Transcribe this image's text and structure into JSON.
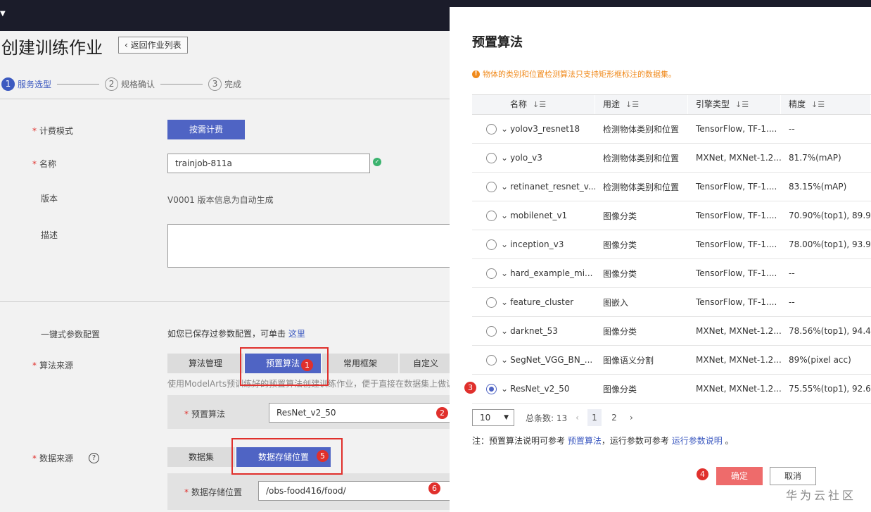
{
  "page": {
    "title": "创建训练作业",
    "back_label": "返回作业列表",
    "steps": [
      {
        "num": "1",
        "label": "服务选型"
      },
      {
        "num": "2",
        "label": "规格确认"
      },
      {
        "num": "3",
        "label": "完成"
      }
    ]
  },
  "form": {
    "billing_label": "计费模式",
    "billing_value": "按需计费",
    "name_label": "名称",
    "name_value": "trainjob-811a",
    "version_label": "版本",
    "version_value": "V0001 版本信息为自动生成",
    "desc_label": "描述",
    "oneclick_label": "一键式参数配置",
    "oneclick_text": "如您已保存过参数配置，可单击",
    "oneclick_link": "这里",
    "algo_source_label": "算法来源",
    "algo_tabs": [
      "算法管理",
      "预置算法",
      "常用框架",
      "自定义"
    ],
    "algo_hint": "使用ModelArts预训练好的预置算法创建训练作业，便于直接在数据集上做训",
    "preset_algo_label": "预置算法",
    "preset_algo_value": "ResNet_v2_50",
    "data_source_label": "数据来源",
    "data_tabs": [
      "数据集",
      "数据存储位置"
    ],
    "data_loc_label": "数据存储位置",
    "data_loc_value": "/obs-food416/food/"
  },
  "annotations": [
    "1",
    "2",
    "3",
    "4",
    "5",
    "6"
  ],
  "modal": {
    "title": "预置算法",
    "notice": "物体的类别和位置检测算法只支持矩形框标注的数据集。",
    "columns": [
      "名称",
      "用途",
      "引擎类型",
      "精度"
    ],
    "rows": [
      {
        "name": "yolov3_resnet18",
        "use": "检测物体类别和位置",
        "engine": "TensorFlow,  TF-1....",
        "acc": "--"
      },
      {
        "name": "yolo_v3",
        "use": "检测物体类别和位置",
        "engine": "MXNet,  MXNet-1.2...",
        "acc": "81.7%(mAP)"
      },
      {
        "name": "retinanet_resnet_v...",
        "use": "检测物体类别和位置",
        "engine": "TensorFlow,  TF-1....",
        "acc": "83.15%(mAP)"
      },
      {
        "name": "mobilenet_v1",
        "use": "图像分类",
        "engine": "TensorFlow,  TF-1....",
        "acc": "70.90%(top1), 89.9..."
      },
      {
        "name": "inception_v3",
        "use": "图像分类",
        "engine": "TensorFlow,  TF-1....",
        "acc": "78.00%(top1), 93.9..."
      },
      {
        "name": "hard_example_mi...",
        "use": "图像分类",
        "engine": "TensorFlow,  TF-1....",
        "acc": "--"
      },
      {
        "name": "feature_cluster",
        "use": "图嵌入",
        "engine": "TensorFlow,  TF-1....",
        "acc": "--"
      },
      {
        "name": "darknet_53",
        "use": "图像分类",
        "engine": "MXNet,  MXNet-1.2...",
        "acc": "78.56%(top1), 94.4..."
      },
      {
        "name": "SegNet_VGG_BN_...",
        "use": "图像语义分割",
        "engine": "MXNet,  MXNet-1.2...",
        "acc": "89%(pixel acc)"
      },
      {
        "name": "ResNet_v2_50",
        "use": "图像分类",
        "engine": "MXNet,  MXNet-1.2...",
        "acc": "75.55%(top1), 92.6..."
      }
    ],
    "page_size": "10",
    "total_label": "总条数: 13",
    "pages": [
      "1",
      "2"
    ],
    "footnote_prefix": "注：预置算法说明可参考",
    "footnote_link1": "预置算法",
    "footnote_mid": "，运行参数可参考",
    "footnote_link2": "运行参数说明",
    "footnote_suffix": "。",
    "ok_label": "确定",
    "cancel_label": "取消"
  },
  "watermark": "华为云社区"
}
